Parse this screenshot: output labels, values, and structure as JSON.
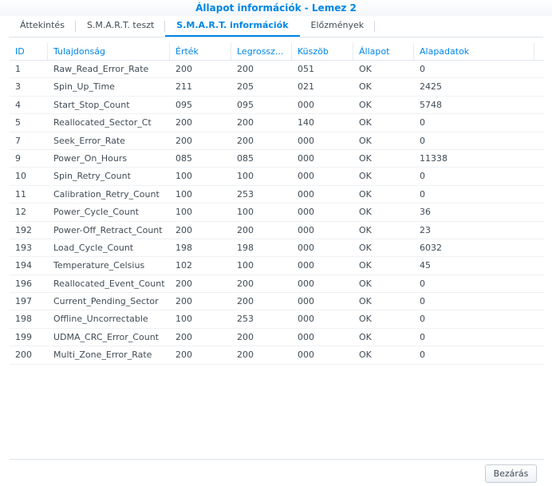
{
  "window": {
    "title": "Állapot információk - Lemez 2"
  },
  "tabs": [
    {
      "label": "Áttekintés",
      "active": false
    },
    {
      "label": "S.M.A.R.T. teszt",
      "active": false
    },
    {
      "label": "S.M.A.R.T. információk",
      "active": true
    },
    {
      "label": "Előzmények",
      "active": false
    }
  ],
  "table": {
    "columns": [
      "ID",
      "Tulajdonság",
      "Érték",
      "Legrossz...",
      "Küszöb",
      "Állapot",
      "Alapadatok"
    ],
    "rows": [
      [
        "1",
        "Raw_Read_Error_Rate",
        "200",
        "200",
        "051",
        "OK",
        "0"
      ],
      [
        "3",
        "Spin_Up_Time",
        "211",
        "205",
        "021",
        "OK",
        "2425"
      ],
      [
        "4",
        "Start_Stop_Count",
        "095",
        "095",
        "000",
        "OK",
        "5748"
      ],
      [
        "5",
        "Reallocated_Sector_Ct",
        "200",
        "200",
        "140",
        "OK",
        "0"
      ],
      [
        "7",
        "Seek_Error_Rate",
        "200",
        "200",
        "000",
        "OK",
        "0"
      ],
      [
        "9",
        "Power_On_Hours",
        "085",
        "085",
        "000",
        "OK",
        "11338"
      ],
      [
        "10",
        "Spin_Retry_Count",
        "100",
        "100",
        "000",
        "OK",
        "0"
      ],
      [
        "11",
        "Calibration_Retry_Count",
        "100",
        "253",
        "000",
        "OK",
        "0"
      ],
      [
        "12",
        "Power_Cycle_Count",
        "100",
        "100",
        "000",
        "OK",
        "36"
      ],
      [
        "192",
        "Power-Off_Retract_Count",
        "200",
        "200",
        "000",
        "OK",
        "23"
      ],
      [
        "193",
        "Load_Cycle_Count",
        "198",
        "198",
        "000",
        "OK",
        "6032"
      ],
      [
        "194",
        "Temperature_Celsius",
        "102",
        "100",
        "000",
        "OK",
        "45"
      ],
      [
        "196",
        "Reallocated_Event_Count",
        "200",
        "200",
        "000",
        "OK",
        "0"
      ],
      [
        "197",
        "Current_Pending_Sector",
        "200",
        "200",
        "000",
        "OK",
        "0"
      ],
      [
        "198",
        "Offline_Uncorrectable",
        "100",
        "253",
        "000",
        "OK",
        "0"
      ],
      [
        "199",
        "UDMA_CRC_Error_Count",
        "200",
        "200",
        "000",
        "OK",
        "0"
      ],
      [
        "200",
        "Multi_Zone_Error_Rate",
        "200",
        "200",
        "000",
        "OK",
        "0"
      ]
    ]
  },
  "footer": {
    "close_label": "Bezárás"
  },
  "colors": {
    "accent": "#0086e5",
    "text": "#414b55"
  }
}
